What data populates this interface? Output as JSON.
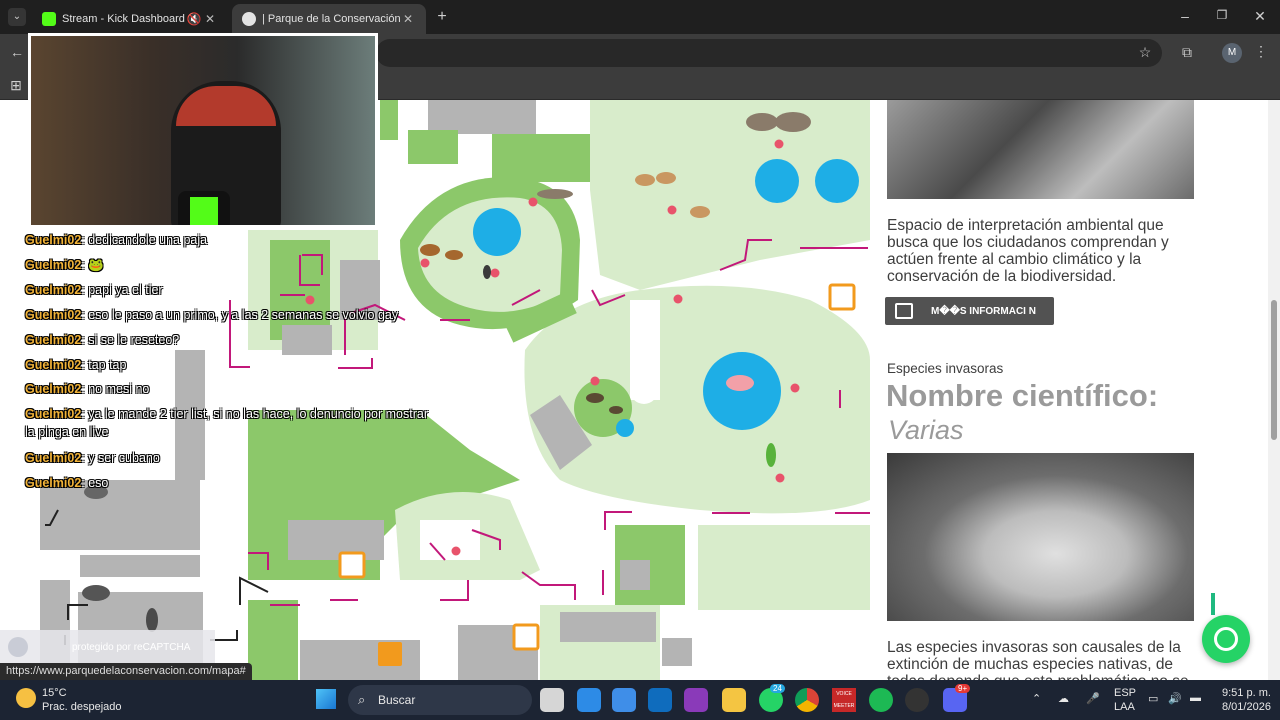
{
  "browser": {
    "tabs": [
      {
        "title": "Stream - Kick Dashboard",
        "active": false
      },
      {
        "title": "| Parque de la Conservación",
        "active": true
      }
    ],
    "profile_initial": "M"
  },
  "sidebar": {
    "paragraph1": "Espacio de interpretación ambiental que busca que los ciudadanos comprendan y actúen frente al cambio climático y la conservación de la biodiversidad.",
    "more_button": "M��S INFORMACI N",
    "section_label": "Especies invasoras",
    "sci_heading": "Nombre científico:",
    "sci_value": "Varias",
    "paragraph2": "Las especies invasoras son causales de la extinción de muchas especies nativas, de todas depende que esta problemático no se"
  },
  "stream": {
    "chat": [
      {
        "user": "Guelmi02",
        "msg": "dedicandole una paja"
      },
      {
        "user": "Guelmi02",
        "msg": "🐸"
      },
      {
        "user": "Guelmi02",
        "msg": "papi ya el tier"
      },
      {
        "user": "Guelmi02",
        "msg": "eso le paso a un primo, y a las 2 semanas se volvio gay"
      },
      {
        "user": "Guelmi02",
        "msg": "si se le reseteo?"
      },
      {
        "user": "Guelmi02",
        "msg": "tap tap"
      },
      {
        "user": "Guelmi02",
        "msg": "no mesi no"
      },
      {
        "user": "Guelmi02",
        "msg": "ya le mande 2 tier list, si no las hace, lo denuncio por mostrar"
      },
      {
        "user": "",
        "msg": "la pinga en live"
      },
      {
        "user": "Guelmi02",
        "msg": "y ser cubano"
      },
      {
        "user": "Guelmi02",
        "msg": "eso"
      }
    ]
  },
  "page_overlays": {
    "recaptcha": "protegido por reCAPTCHA",
    "status_url": "https://www.parquedelaconservacion.com/mapa#"
  },
  "taskbar": {
    "weather_temp": "15°C",
    "weather_desc": "Prac. despejado",
    "search_placeholder": "Buscar",
    "lang1": "ESP",
    "lang2": "LAA",
    "time": "9:51 p. m.",
    "date": "8/01/2026",
    "whatsapp_badge": "24",
    "discord_badge": "9+",
    "voicemeeter_label": "VOICE MEETER"
  },
  "colors": {
    "accent_green": "#53fc18",
    "map_green_dark": "#8cc86a",
    "map_green_light": "#d8eccb",
    "map_gray": "#b4b4b4",
    "water_blue": "#1eaee6",
    "marker_red": "#e8536b",
    "arrow_magenta": "#c2187a",
    "wc_orange": "#f29a1d"
  }
}
